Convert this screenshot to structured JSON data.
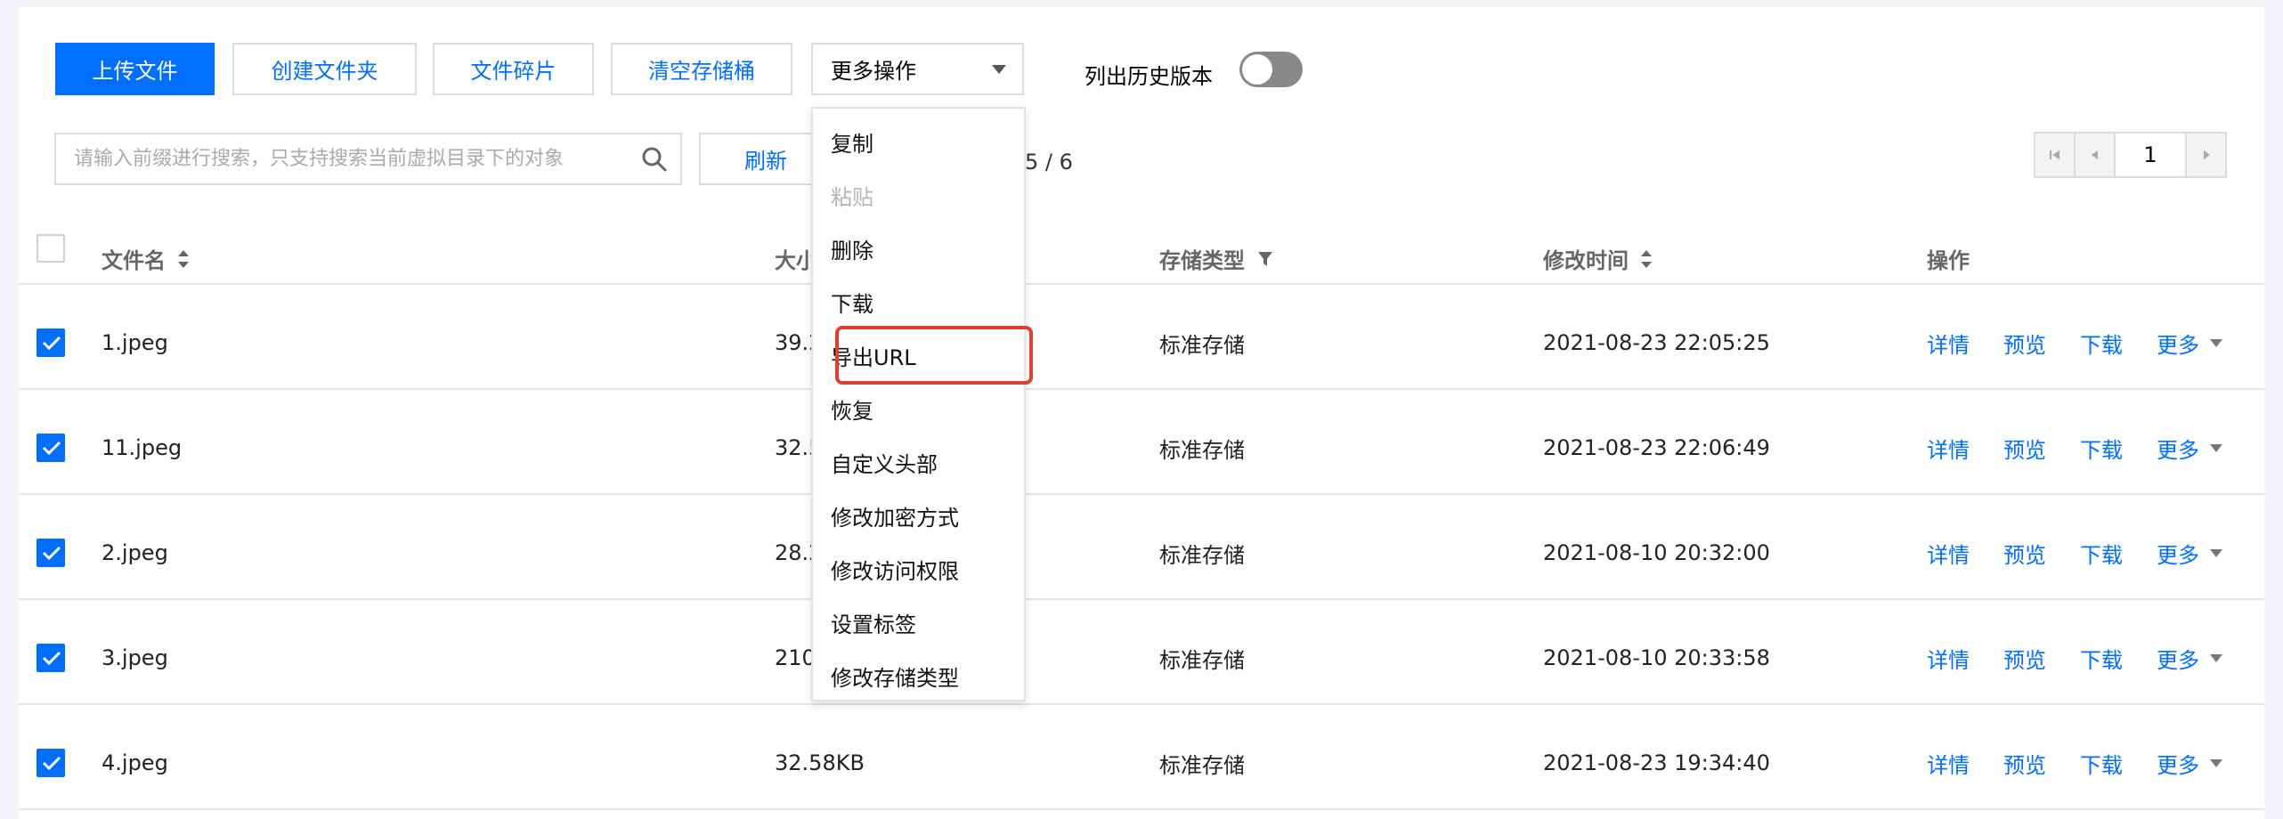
{
  "toolbar": {
    "upload": "上传文件",
    "create_folder": "创建文件夹",
    "fragments": "文件碎片",
    "clear_bucket": "清空存储桶",
    "more_ops": "更多操作",
    "history_label": "列出历史版本"
  },
  "search": {
    "placeholder": "请输入前缀进行搜索，只支持搜索当前虚拟目录下的对象",
    "refresh": "刷新",
    "selection_count_fragment": "5 / 6"
  },
  "pager": {
    "page": "1"
  },
  "table": {
    "headers": {
      "name": "文件名",
      "size": "大小",
      "storage": "存储类型",
      "mtime": "修改时间",
      "ops": "操作"
    },
    "rows": [
      {
        "name": "1.jpeg",
        "size": "39.2",
        "storage": "标准存储",
        "mtime": "2021-08-23 22:05:25"
      },
      {
        "name": "11.jpeg",
        "size": "32.5",
        "storage": "标准存储",
        "mtime": "2021-08-23 22:06:49"
      },
      {
        "name": "2.jpeg",
        "size": "28.2",
        "storage": "标准存储",
        "mtime": "2021-08-10 20:32:00"
      },
      {
        "name": "3.jpeg",
        "size": "210",
        "storage": "标准存储",
        "mtime": "2021-08-10 20:33:58"
      },
      {
        "name": "4.jpeg",
        "size": "32.58KB",
        "storage": "标准存储",
        "mtime": "2021-08-23 19:34:40"
      }
    ],
    "ops": {
      "detail": "详情",
      "preview": "预览",
      "download": "下载",
      "more": "更多"
    }
  },
  "dropdown": {
    "items": [
      {
        "label": "复制",
        "disabled": false
      },
      {
        "label": "粘贴",
        "disabled": true
      },
      {
        "label": "删除",
        "disabled": false
      },
      {
        "label": "下载",
        "disabled": false
      },
      {
        "label": "导出URL",
        "disabled": false
      },
      {
        "label": "恢复",
        "disabled": false
      },
      {
        "label": "自定义头部",
        "disabled": false
      },
      {
        "label": "修改加密方式",
        "disabled": false
      },
      {
        "label": "修改访问权限",
        "disabled": false
      },
      {
        "label": "设置标签",
        "disabled": false
      },
      {
        "label": "修改存储类型",
        "disabled": false
      }
    ]
  },
  "colors": {
    "primary": "#006eff",
    "highlight": "#e0402f"
  }
}
